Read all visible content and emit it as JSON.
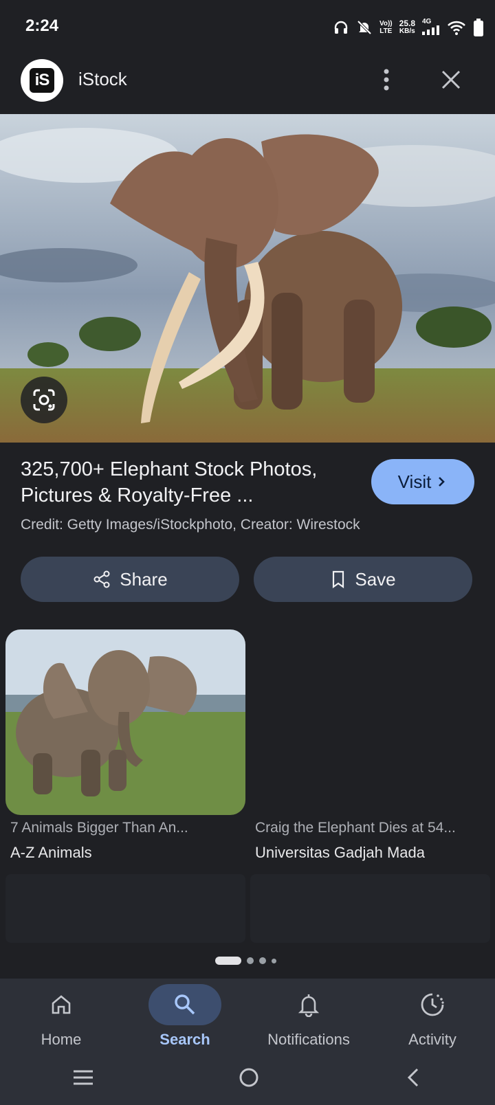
{
  "status_bar": {
    "time": "2:24",
    "volte_top": "Vo))",
    "volte_bottom": "LTE",
    "speed_value": "25.8",
    "speed_unit": "KB/s",
    "network": "4G"
  },
  "header": {
    "site_logo_text": "iS",
    "site_name": "iStock"
  },
  "result": {
    "title": "325,700+ Elephant Stock Photos, Pictures & Royalty-Free ...",
    "visit_label": "Visit",
    "credit": "Credit: Getty Images/iStockphoto, Creator: Wirestock",
    "share_label": "Share",
    "save_label": "Save"
  },
  "related": [
    {
      "title": "7 Animals Bigger Than An...",
      "source": "A-Z Animals"
    },
    {
      "title": "Craig the Elephant Dies at 54...",
      "source": "Universitas Gadjah Mada"
    }
  ],
  "bottom_nav": [
    {
      "label": "Home",
      "icon": "home-icon"
    },
    {
      "label": "Search",
      "icon": "search-icon",
      "active": true
    },
    {
      "label": "Notifications",
      "icon": "bell-icon"
    },
    {
      "label": "Activity",
      "icon": "activity-icon"
    }
  ],
  "colors": {
    "background": "#1f2024",
    "accent": "#8ab4f8",
    "pill": "#3a4456",
    "nav_bg": "#2d3038"
  }
}
